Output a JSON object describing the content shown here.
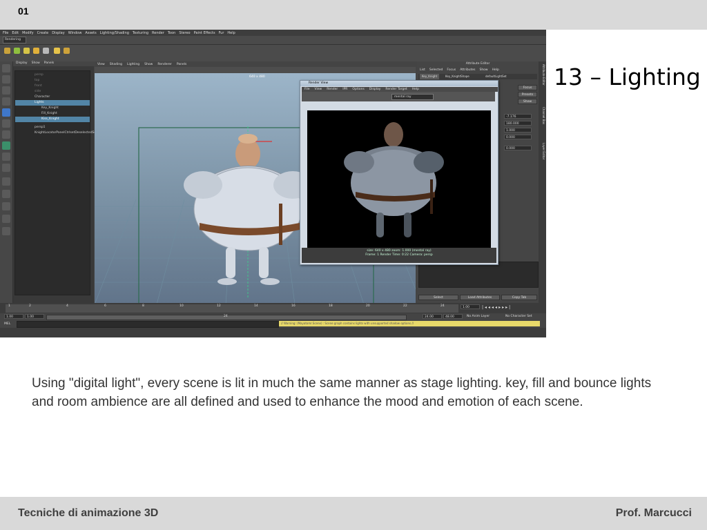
{
  "slide_number": "01",
  "title": "13 – Lighting",
  "body": "Using \"digital light\", every scene is lit in much the same manner as stage lighting. key, fill and bounce lights and room ambience are all defined and used to enhance the mood and emotion of each scene.",
  "footer": {
    "course": "Tecniche di animazione 3D",
    "professor": "Prof. Marcucci"
  },
  "maya": {
    "menu": [
      "File",
      "Edit",
      "Modify",
      "Create",
      "Display",
      "Window",
      "Assets",
      "Lighting/Shading",
      "Texturing",
      "Render",
      "Toon",
      "Stereo",
      "Paint Effects",
      "Fur",
      "Help"
    ],
    "module": "Rendering",
    "outliner_menu": [
      "Display",
      "Show",
      "Panels"
    ],
    "outliner_items": [
      "persp",
      "top",
      "front",
      "side",
      "Character",
      "Lights",
      "Key_Knight",
      "Fill_Knight",
      "Kiss_Knight",
      "persp1",
      "KnightLocatorPanelCtrlsetDeselectedSet"
    ],
    "viewport_menu": [
      "View",
      "Shading",
      "Lighting",
      "Show",
      "Renderer",
      "Panels"
    ],
    "viewport_resolution": "640 x 480",
    "render_window": {
      "title": "Render View",
      "menu": [
        "File",
        "View",
        "Render",
        "IPR",
        "Options",
        "Display",
        "Render Target",
        "Help"
      ],
      "renderer": "mental ray",
      "info_line1": "size: 640 x 480   zoom: 1.000      (mental ray)",
      "info_line2": "Frame: 1     Render Time: 0:22     Camera: persp"
    },
    "attribute_editor": {
      "title": "Attribute Editor",
      "menu": [
        "List",
        "Selected",
        "Focus",
        "Attributes",
        "Show",
        "Help"
      ],
      "tabs": [
        "Key_Knight",
        "Key_KnightShape",
        "defaultLightSet"
      ],
      "buttons": {
        "focus": "Focus",
        "presets": "Presets",
        "show": "Show"
      },
      "values": [
        "-7.176",
        "180.000",
        "1.000",
        "0.000",
        "0.000"
      ],
      "notes_label": "Notes: Kiss_Knight",
      "bottom_buttons": [
        "Select",
        "Load Attributes",
        "Copy Tab"
      ]
    },
    "side_tabs": [
      "Attribute Editor",
      "Channel Box",
      "Layer Editor"
    ],
    "timeline_ticks": [
      "1",
      "2",
      "4",
      "6",
      "8",
      "10",
      "12",
      "14",
      "16",
      "18",
      "20",
      "22",
      "24"
    ],
    "current_frame": "1.00",
    "range": {
      "start": "1.00",
      "anim_start": "1.00",
      "slider_label": "24",
      "anim_end": "24.00",
      "end": "48.00",
      "anim_layer": "No Anim Layer",
      "char_set": "No Character Set"
    },
    "cmd_label": "MEL",
    "cmd_result": "// Warning: (Mayatomr.Scene) : Scene graph contains lights with unsupported shadow options //"
  }
}
